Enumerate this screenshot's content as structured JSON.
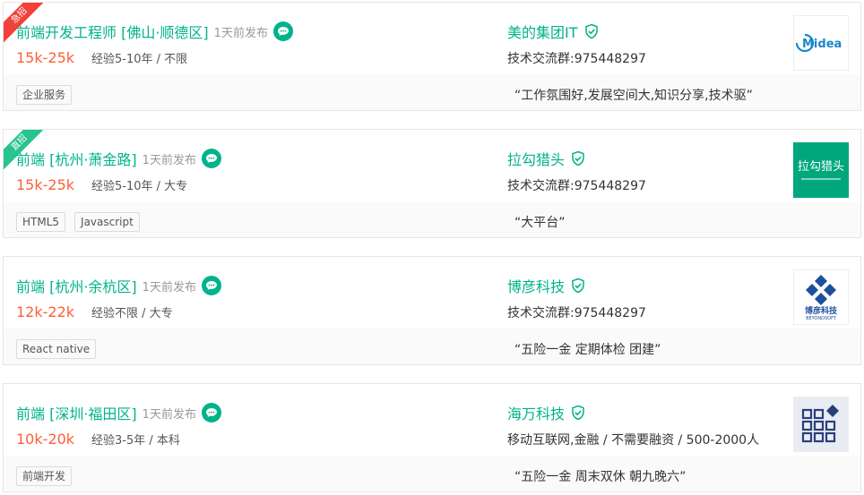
{
  "jobs": [
    {
      "ribbon": "急招",
      "ribbon_type": "urgent",
      "title": "前端开发工程师 [佛山·顺德区]",
      "posted": "1天前发布",
      "salary": "15k-25k",
      "requirement": "经验5-10年 / 不限",
      "company_name": "美的集团IT",
      "company_info": "技术交流群:975448297",
      "tags": [
        "企业服务"
      ],
      "slogan": "“工作氛围好,发展空间大,知识分享,技术驱”",
      "logo": {
        "kind": "midea",
        "text": "Midea",
        "color": "#1a86c8"
      }
    },
    {
      "ribbon": "直招",
      "ribbon_type": "direct",
      "title": "前端 [杭州·萧金路]",
      "posted": "1天前发布",
      "salary": "15k-25k",
      "requirement": "经验5-10年 / 大专",
      "company_name": "拉勾猎头",
      "company_info": "技术交流群:975448297",
      "tags": [
        "HTML5",
        "Javascript"
      ],
      "slogan": "“大平台”",
      "logo": {
        "kind": "lagou",
        "text": "拉勾猎头",
        "color": "#00a77d"
      }
    },
    {
      "ribbon": "",
      "ribbon_type": "",
      "title": "前端 [杭州·余杭区]",
      "posted": "1天前发布",
      "salary": "12k-22k",
      "requirement": "经验不限 / 大专",
      "company_name": "博彦科技",
      "company_info": "技术交流群:975448297",
      "tags": [
        "React native"
      ],
      "slogan": "“五险一金 定期体检 团建”",
      "logo": {
        "kind": "beyond",
        "text": "博彦科技",
        "subtext": "BEYONDSOFT",
        "color": "#1d4f9c"
      }
    },
    {
      "ribbon": "",
      "ribbon_type": "",
      "title": "前端 [深圳·福田区]",
      "posted": "1天前发布",
      "salary": "10k-20k",
      "requirement": "经验3-5年 / 本科",
      "company_name": "海万科技",
      "company_info": "移动互联网,金融 / 不需要融资 / 500-2000人",
      "tags": [
        "前端开发"
      ],
      "slogan": "“五险一金 周末双休 朝九晚六”",
      "logo": {
        "kind": "haiwan",
        "color": "#2a3f7a"
      }
    }
  ],
  "colors": {
    "accent": "#00b38a",
    "salary": "#fd5f39",
    "urgent": "#f0413b",
    "direct": "#27c391"
  }
}
